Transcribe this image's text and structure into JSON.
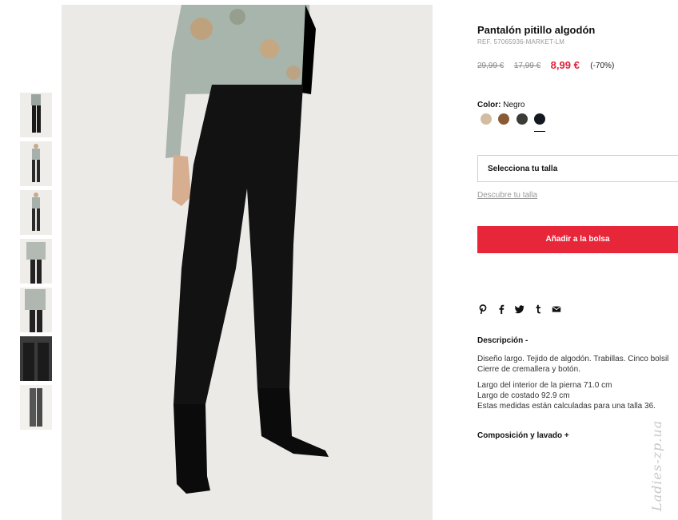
{
  "product": {
    "title": "Pantalón pitillo algodón",
    "ref": "REF. 57065936-MARKET-LM",
    "price_original": "29,99 €",
    "price_previous": "17,99 €",
    "price_current": "8,99 €",
    "discount": "(-70%)"
  },
  "color": {
    "label": "Color:",
    "selected": "Negro",
    "swatches": [
      {
        "name": "beige",
        "hex": "#d3bda2"
      },
      {
        "name": "brown",
        "hex": "#8a5a34"
      },
      {
        "name": "dark-grey",
        "hex": "#3b3b38"
      },
      {
        "name": "black",
        "hex": "#141820"
      }
    ]
  },
  "size": {
    "placeholder": "Selecciona tu talla",
    "guide_link": "Descubre tu talla"
  },
  "cart": {
    "add_label": "Añadir a la bolsa"
  },
  "share_icons": [
    "pinterest-icon",
    "facebook-icon",
    "twitter-icon",
    "tumblr-icon",
    "email-icon"
  ],
  "description": {
    "heading": "Descripción  -",
    "lines": [
      "Diseño largo. Tejido de algodón. Trabillas. Cinco bolsil",
      "Cierre de cremallera y botón."
    ],
    "measurements": [
      "Largo del interior de la pierna 71.0 cm",
      "Largo de costado 92.9 cm",
      "Estas medidas están calculadas para una talla 36."
    ]
  },
  "composition": {
    "heading": "Composición y lavado  +"
  },
  "watermark": "Ladies-zp.ua",
  "colors": {
    "accent": "#e8263a",
    "price_new": "#e0223a"
  }
}
